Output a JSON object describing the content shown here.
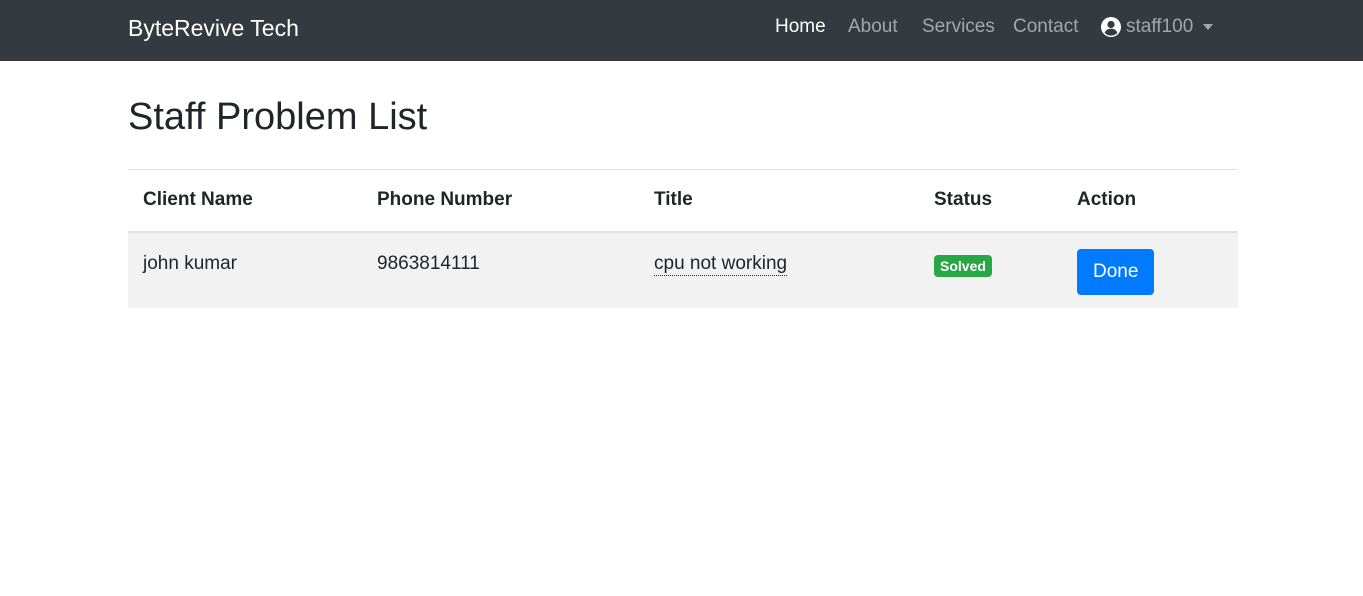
{
  "navbar": {
    "brand": "ByteRevive Tech",
    "links": [
      {
        "label": "Home",
        "active": true
      },
      {
        "label": "About",
        "active": false
      },
      {
        "label": "Services",
        "active": false
      },
      {
        "label": "Contact",
        "active": false
      }
    ],
    "user": {
      "icon": "user-circle-icon",
      "username": "staff100",
      "caret_icon": "caret-down-icon"
    }
  },
  "page": {
    "title": "Staff Problem List"
  },
  "table": {
    "headers": [
      "Client Name",
      "Phone Number",
      "Title",
      "Status",
      "Action"
    ],
    "rows": [
      {
        "client_name": "john kumar",
        "phone_number": "9863814111",
        "title": "cpu not working",
        "status": "Solved",
        "action": "Done"
      }
    ]
  },
  "colors": {
    "navbar_bg": "#343a40",
    "status_solved": "#28a745",
    "primary_button": "#007bff",
    "row_bg": "#f2f2f2"
  }
}
